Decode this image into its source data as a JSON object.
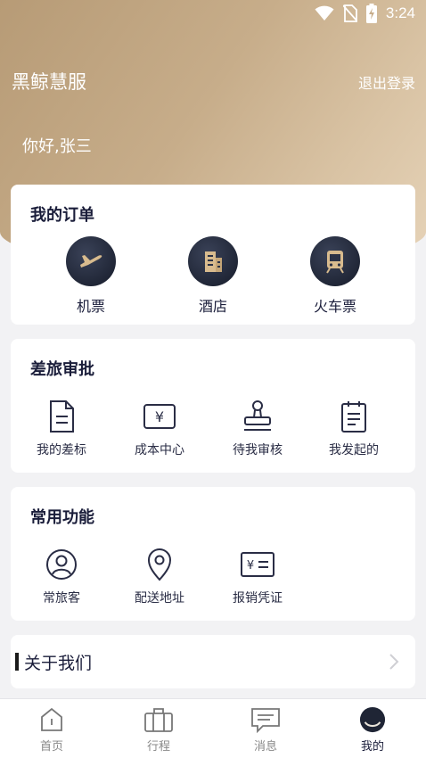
{
  "status_bar": {
    "time": "3:24",
    "icons": [
      "wifi-icon",
      "no-sim-icon",
      "battery-charging-icon"
    ]
  },
  "header": {
    "app_title": "黑鲸慧服",
    "logout_label": "退出登录",
    "greeting": "你好,张三"
  },
  "orders": {
    "title": "我的订单",
    "items": [
      {
        "label": "机票",
        "icon": "airplane-icon"
      },
      {
        "label": "酒店",
        "icon": "hotel-icon"
      },
      {
        "label": "火车票",
        "icon": "train-icon"
      }
    ]
  },
  "approval": {
    "title": "差旅审批",
    "items": [
      {
        "label": "我的差标",
        "icon": "document-icon"
      },
      {
        "label": "成本中心",
        "icon": "yen-icon"
      },
      {
        "label": "待我审核",
        "icon": "stamp-icon"
      },
      {
        "label": "我发起的",
        "icon": "clipboard-icon"
      }
    ]
  },
  "functions": {
    "title": "常用功能",
    "items": [
      {
        "label": "常旅客",
        "icon": "user-icon"
      },
      {
        "label": "配送地址",
        "icon": "location-icon"
      },
      {
        "label": "报销凭证",
        "icon": "receipt-icon"
      }
    ]
  },
  "about": {
    "label": "关于我们"
  },
  "tabbar": {
    "items": [
      {
        "label": "首页",
        "icon": "home-icon"
      },
      {
        "label": "行程",
        "icon": "luggage-icon"
      },
      {
        "label": "消息",
        "icon": "message-icon"
      },
      {
        "label": "我的",
        "icon": "profile-icon"
      }
    ],
    "active": "我的"
  },
  "colors": {
    "brand_gold": "#c7ad8a",
    "navy": "#1a1d3a",
    "background": "#f2f2f4"
  }
}
